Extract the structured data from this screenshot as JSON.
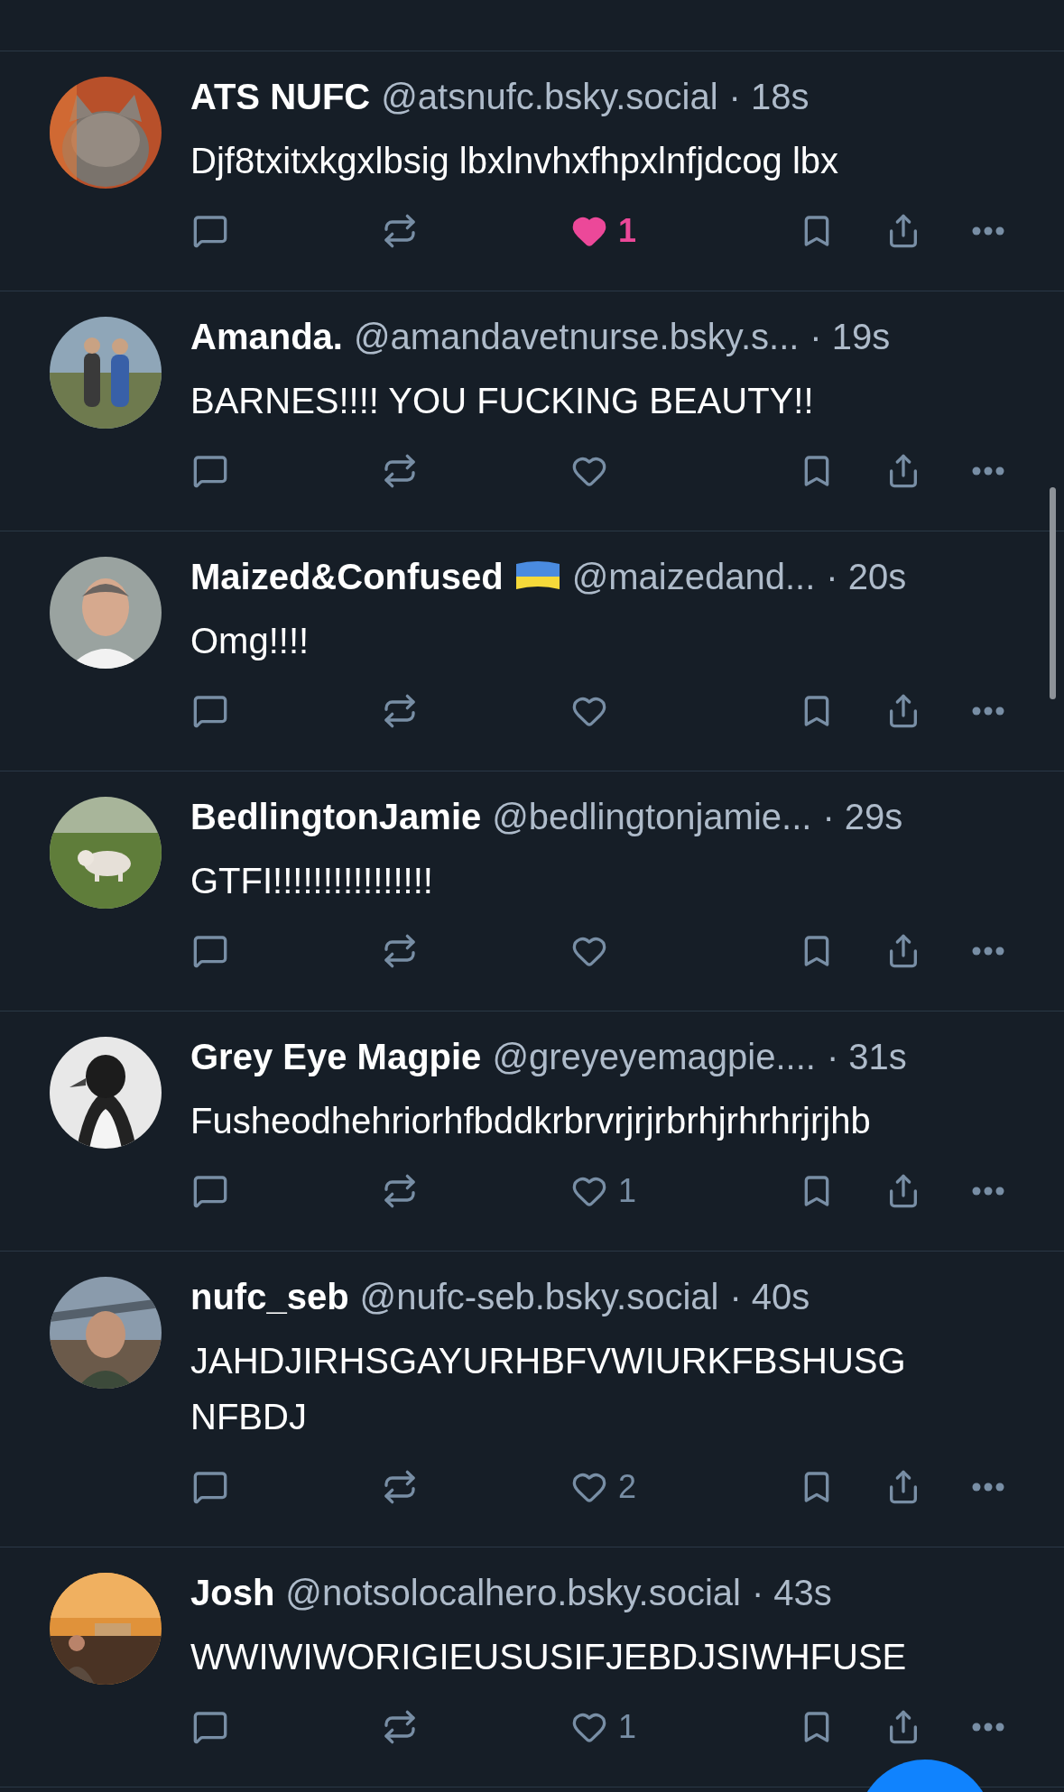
{
  "posts": [
    {
      "author": "ATS NUFC",
      "flag_icon": false,
      "handle": "@atsnufc.bsky.social",
      "time": "· 18s",
      "text": "Djf8txitxkgxlbsig lbxlnvhxfhpxlnfjdcog lbx",
      "liked": true,
      "likes": "1"
    },
    {
      "author": "Amanda.",
      "flag_icon": false,
      "handle": "@amandavetnurse.bsky.s...",
      "time": "· 19s",
      "text": "BARNES!!!! YOU FUCKING BEAUTY!!",
      "liked": false
    },
    {
      "author": "Maized&Confused",
      "flag_icon": true,
      "handle": "@maizedand...",
      "time": "· 20s",
      "text": "Omg!!!!",
      "liked": false
    },
    {
      "author": "BedlingtonJamie",
      "flag_icon": false,
      "handle": "@bedlingtonjamie...",
      "time": "· 29s",
      "text": "GTFI!!!!!!!!!!!!!!!!",
      "liked": false
    },
    {
      "author": "Grey Eye Magpie",
      "flag_icon": false,
      "handle": "@greyeyemagpie....",
      "time": "· 31s",
      "text": "Fusheodhehriorhfbddkrbrvrjrjrbrhjrhrhrjrjhb",
      "liked": false,
      "likes": "1"
    },
    {
      "author": "nufc_seb",
      "flag_icon": false,
      "handle": "@nufc-seb.bsky.social",
      "time": "· 40s",
      "text": "JAHDJIRHSGAYURHBFVWIURKFBSHUSG\nNFBDJ",
      "liked": false,
      "likes": "2"
    },
    {
      "author": "Josh",
      "flag_icon": false,
      "handle": "@notsolocalhero.bsky.social",
      "time": "· 43s",
      "text": "WWIWIWORIGIEUSUSIFJEBDJSIWHFUSE",
      "liked": false,
      "likes": "1"
    }
  ]
}
